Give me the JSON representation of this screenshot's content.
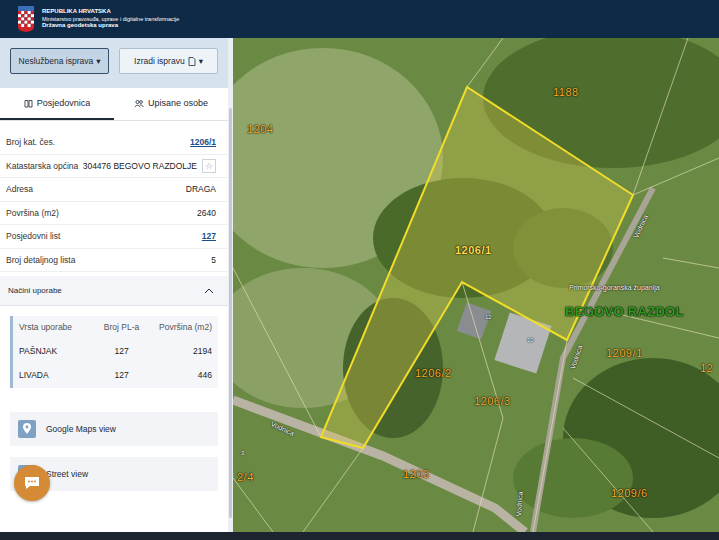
{
  "header": {
    "country": "REPUBLIKA HRVATSKA",
    "ministry": "Ministarstvo pravosuđa, uprave i digitalne transformacije",
    "agency": "Državna geodetska uprava"
  },
  "toolbar": [
    {
      "label": "Neslužbena isprava",
      "caret": "▾",
      "selected": true,
      "document": false
    },
    {
      "label": "Izradi ispravu",
      "caret": "▾",
      "selected": false,
      "document": true
    }
  ],
  "tabs": [
    {
      "label": "Posjedovnica",
      "selected": true
    },
    {
      "label": "Upisane osobe",
      "selected": false
    }
  ],
  "fields": [
    {
      "label": "Broj kat. čes.",
      "value": "1206/1",
      "link": true,
      "favorite": ""
    },
    {
      "label": "Katastarska općina",
      "value": "304476 BEGOVO RAZDOLJE",
      "link": false,
      "favorite": "☆"
    },
    {
      "label": "Adresa",
      "value": "DRAGA",
      "link": false,
      "favorite": ""
    },
    {
      "label": "Površina (m2)",
      "value": "2640",
      "link": false,
      "favorite": ""
    },
    {
      "label": "Posjedovni list",
      "value": "127",
      "link": true,
      "favorite": ""
    },
    {
      "label": "Broj detaljnog lista",
      "value": "5",
      "link": false,
      "favorite": ""
    }
  ],
  "usage": {
    "title": "Načini uporabe",
    "expanded": true,
    "columns": [
      "Vrsta uporabe",
      "Broj PL-a",
      "Površina (m2)"
    ],
    "rows": [
      [
        "PAŠNJAK",
        "127",
        "2194"
      ],
      [
        "LIVADA",
        "127",
        "446"
      ]
    ]
  },
  "links": [
    "Google Maps view",
    "Street view"
  ],
  "map": {
    "parcels": [
      {
        "label": "1188",
        "selected": false
      },
      {
        "label": "1204",
        "selected": false
      },
      {
        "label": "1206/1",
        "selected": true
      },
      {
        "label": "1206/2",
        "selected": false
      },
      {
        "label": "1206/3",
        "selected": false
      },
      {
        "label": "1209/1",
        "selected": false
      },
      {
        "label": "1209/6",
        "selected": false
      },
      {
        "label": "2/4",
        "selected": false
      },
      {
        "label": "1203",
        "selected": false
      },
      {
        "label": "12",
        "selected": false
      }
    ],
    "region": "Primorsko-goranska županija",
    "municipality": "BEGOVO RAZDOL",
    "house_numbers": [
      "12",
      "10",
      "3"
    ],
    "streets": [
      "Vodnica",
      "Vodnica",
      "Vodnica",
      "Vodnica"
    ]
  }
}
